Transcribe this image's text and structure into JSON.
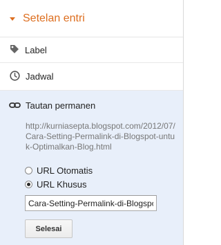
{
  "panel": {
    "title": "Setelan entri",
    "accent_color": "#dd6e1f",
    "items": [
      {
        "label": "Label",
        "icon": "tag-icon"
      },
      {
        "label": "Jadwal",
        "icon": "clock-icon"
      }
    ]
  },
  "permalink": {
    "title": "Tautan permanen",
    "icon": "link-icon",
    "url": "http://kurniasepta.blogspot.com/2012/07/Cara-Setting-Permalink-di-Blogspot-untuk-Optimalkan-Blog.html",
    "options": [
      {
        "label": "URL Otomatis",
        "selected": false
      },
      {
        "label": "URL Khusus",
        "selected": true
      }
    ],
    "custom_value": "Cara-Setting-Permalink-di-Blogspot-untuk-Optimalkan-Blog",
    "done_label": "Selesai",
    "panel_bg": "#e8effa"
  }
}
